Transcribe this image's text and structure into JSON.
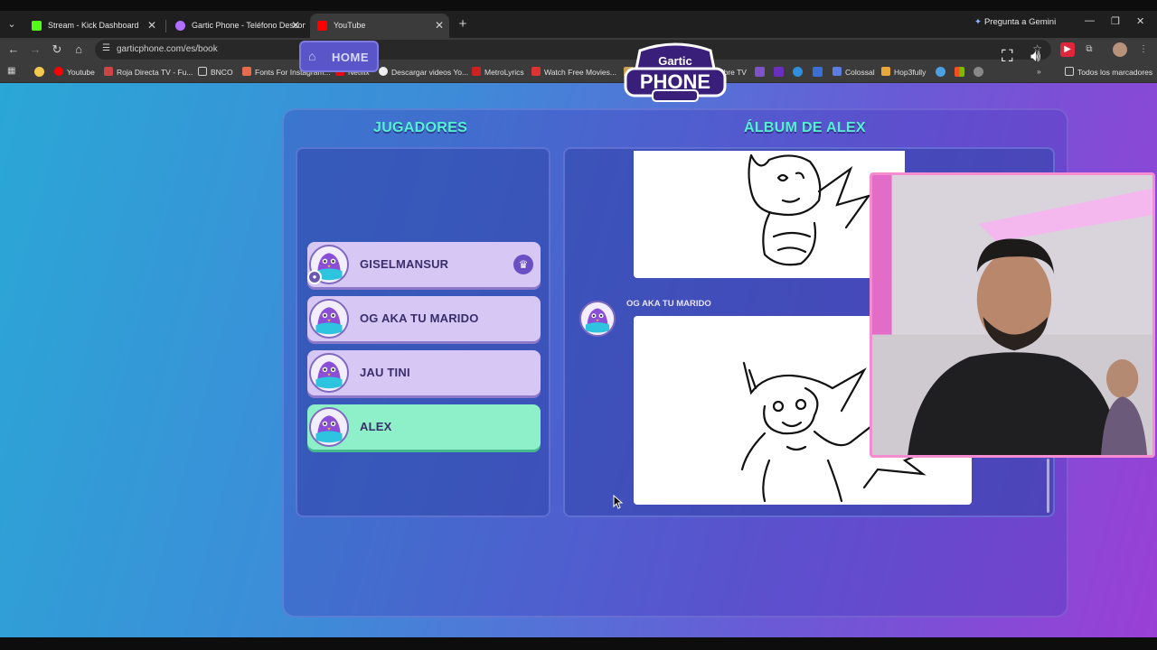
{
  "browser": {
    "tabs": [
      {
        "title": "Stream - Kick Dashboard",
        "favicon_color": "#53fc18",
        "active": false
      },
      {
        "title": "Gartic Phone - Teléfono Descon",
        "favicon_color": "#b070ff",
        "active": false
      },
      {
        "title": "YouTube",
        "favicon_color": "#ff0000",
        "active": true
      }
    ],
    "gemini_label": "Pregunta a Gemini",
    "url": "garticphone.com/es/book",
    "bookmarks": [
      "Youtube",
      "Roja Directa TV - Fu...",
      "BNCO",
      "Fonts For Instagram...",
      "Netflix",
      "Descargar videos Yo...",
      "MetroLyrics",
      "Watch Free Movies...",
      "Fútbol Libre TV",
      "Colossal",
      "Hop3fully"
    ],
    "all_bookmarks_label": "Todos los marcadores"
  },
  "game": {
    "home_label": "HOME",
    "logo_top": "Gartic",
    "logo_bottom": "PHONE",
    "players_title": "JUGADORES",
    "album_title": "ÁLBUM DE ALEX",
    "players": [
      {
        "name": "GISELMANSUR",
        "host": true
      },
      {
        "name": "OG AKA TU MARIDO",
        "host": false
      },
      {
        "name": "JAU TINI",
        "host": false
      },
      {
        "name": "ALEX",
        "host": false,
        "current": true
      }
    ],
    "album_drawer": "OG AKA TU MARIDO"
  },
  "colors": {
    "accent_title": "#55f0d0",
    "player_card": "#d6c7f5",
    "player_current": "#8ef0c9",
    "webcam_border": "#f58bd0"
  }
}
